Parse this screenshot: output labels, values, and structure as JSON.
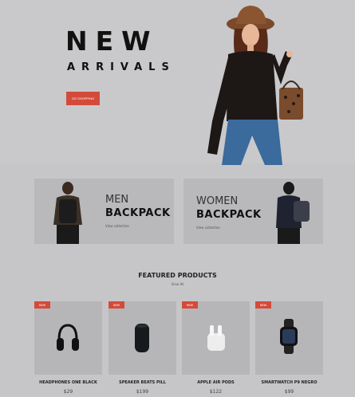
{
  "hero": {
    "title": "NEW",
    "subtitle": "ARRIVALS",
    "button_label": "GO SHOPPING"
  },
  "categories": [
    {
      "line1": "MEN",
      "line2": "BACKPACK",
      "link": "View collection"
    },
    {
      "line1": "WOMEN",
      "line2": "BACKPACK",
      "link": "View collection"
    }
  ],
  "featured": {
    "title": "FEATURED PRODUCTS",
    "view_all": "View All"
  },
  "products": [
    {
      "badge": "NEW",
      "name": "HEADPHONES ONE BLACK",
      "price": "$29",
      "icon": "headphones-icon"
    },
    {
      "badge": "NEW",
      "name": "SPEAKER BEATS PILL",
      "price": "$199",
      "icon": "speaker-icon"
    },
    {
      "badge": "NEW",
      "name": "APPLE AIR PODS",
      "price": "$122",
      "icon": "earbuds-icon"
    },
    {
      "badge": "NEW",
      "name": "SMARTWATCH P9 NEGRO",
      "price": "$99",
      "icon": "smartwatch-icon"
    }
  ],
  "colors": {
    "accent": "#d44a3a",
    "background": "#c6c6c8"
  }
}
